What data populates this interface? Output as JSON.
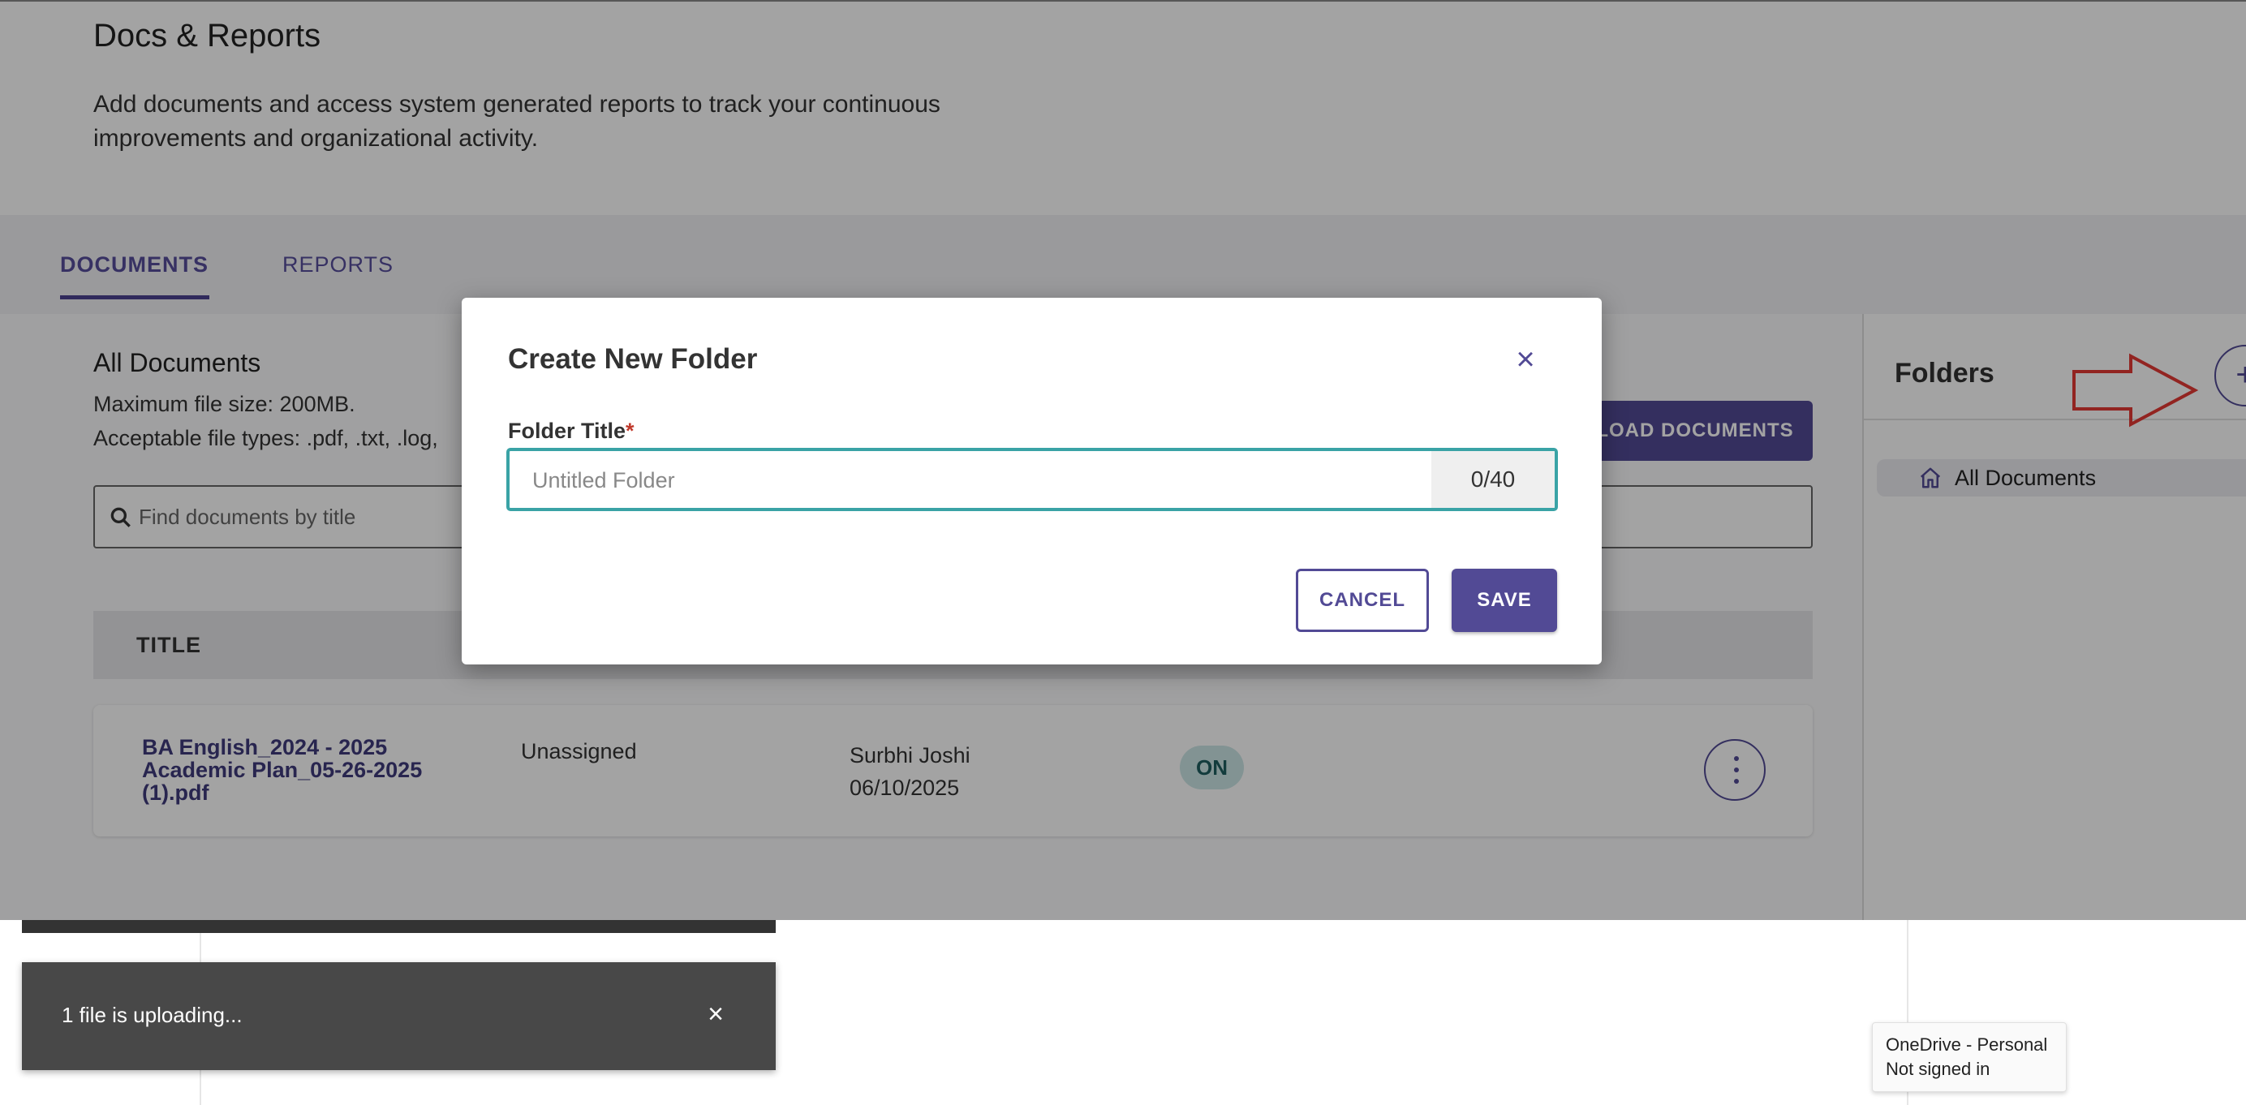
{
  "header": {
    "title": "Docs & Reports",
    "description": "Add documents and access system generated reports to track your continuous improvements and organizational activity."
  },
  "tabs": [
    {
      "label": "DOCUMENTS",
      "active": true
    },
    {
      "label": "REPORTS",
      "active": false
    }
  ],
  "documents": {
    "title": "All Documents",
    "max_size": "Maximum file size: 200MB.",
    "file_types": "Acceptable file types: .pdf, .txt, .log,",
    "upload_label": "UPLOAD DOCUMENTS",
    "search_placeholder": "Find documents by title",
    "columns": [
      "TITLE"
    ],
    "rows": [
      {
        "title": "BA English_2024 - 2025 Academic Plan_05-26-2025 (1).pdf",
        "assignment": "Unassigned",
        "owner": "Surbhi Joshi",
        "date": "06/10/2025",
        "status": "ON"
      }
    ]
  },
  "folders": {
    "title": "Folders",
    "add_label": "+",
    "items": [
      {
        "label": "All Documents"
      }
    ]
  },
  "modal": {
    "title": "Create New Folder",
    "close_label": "×",
    "field_label": "Folder Title",
    "required_mark": "*",
    "placeholder": "Untitled Folder",
    "value": "",
    "char_count": "0/40",
    "cancel_label": "CANCEL",
    "save_label": "SAVE"
  },
  "toast": {
    "text": "1 file is uploading...",
    "close_label": "×"
  },
  "tooltip": {
    "line1": "OneDrive - Personal",
    "line2": "Not signed in"
  },
  "colors": {
    "primary": "#524a95",
    "focus": "#3aa3a6",
    "status_bg": "#cce6e6",
    "annotation_arrow": "#e53935"
  }
}
